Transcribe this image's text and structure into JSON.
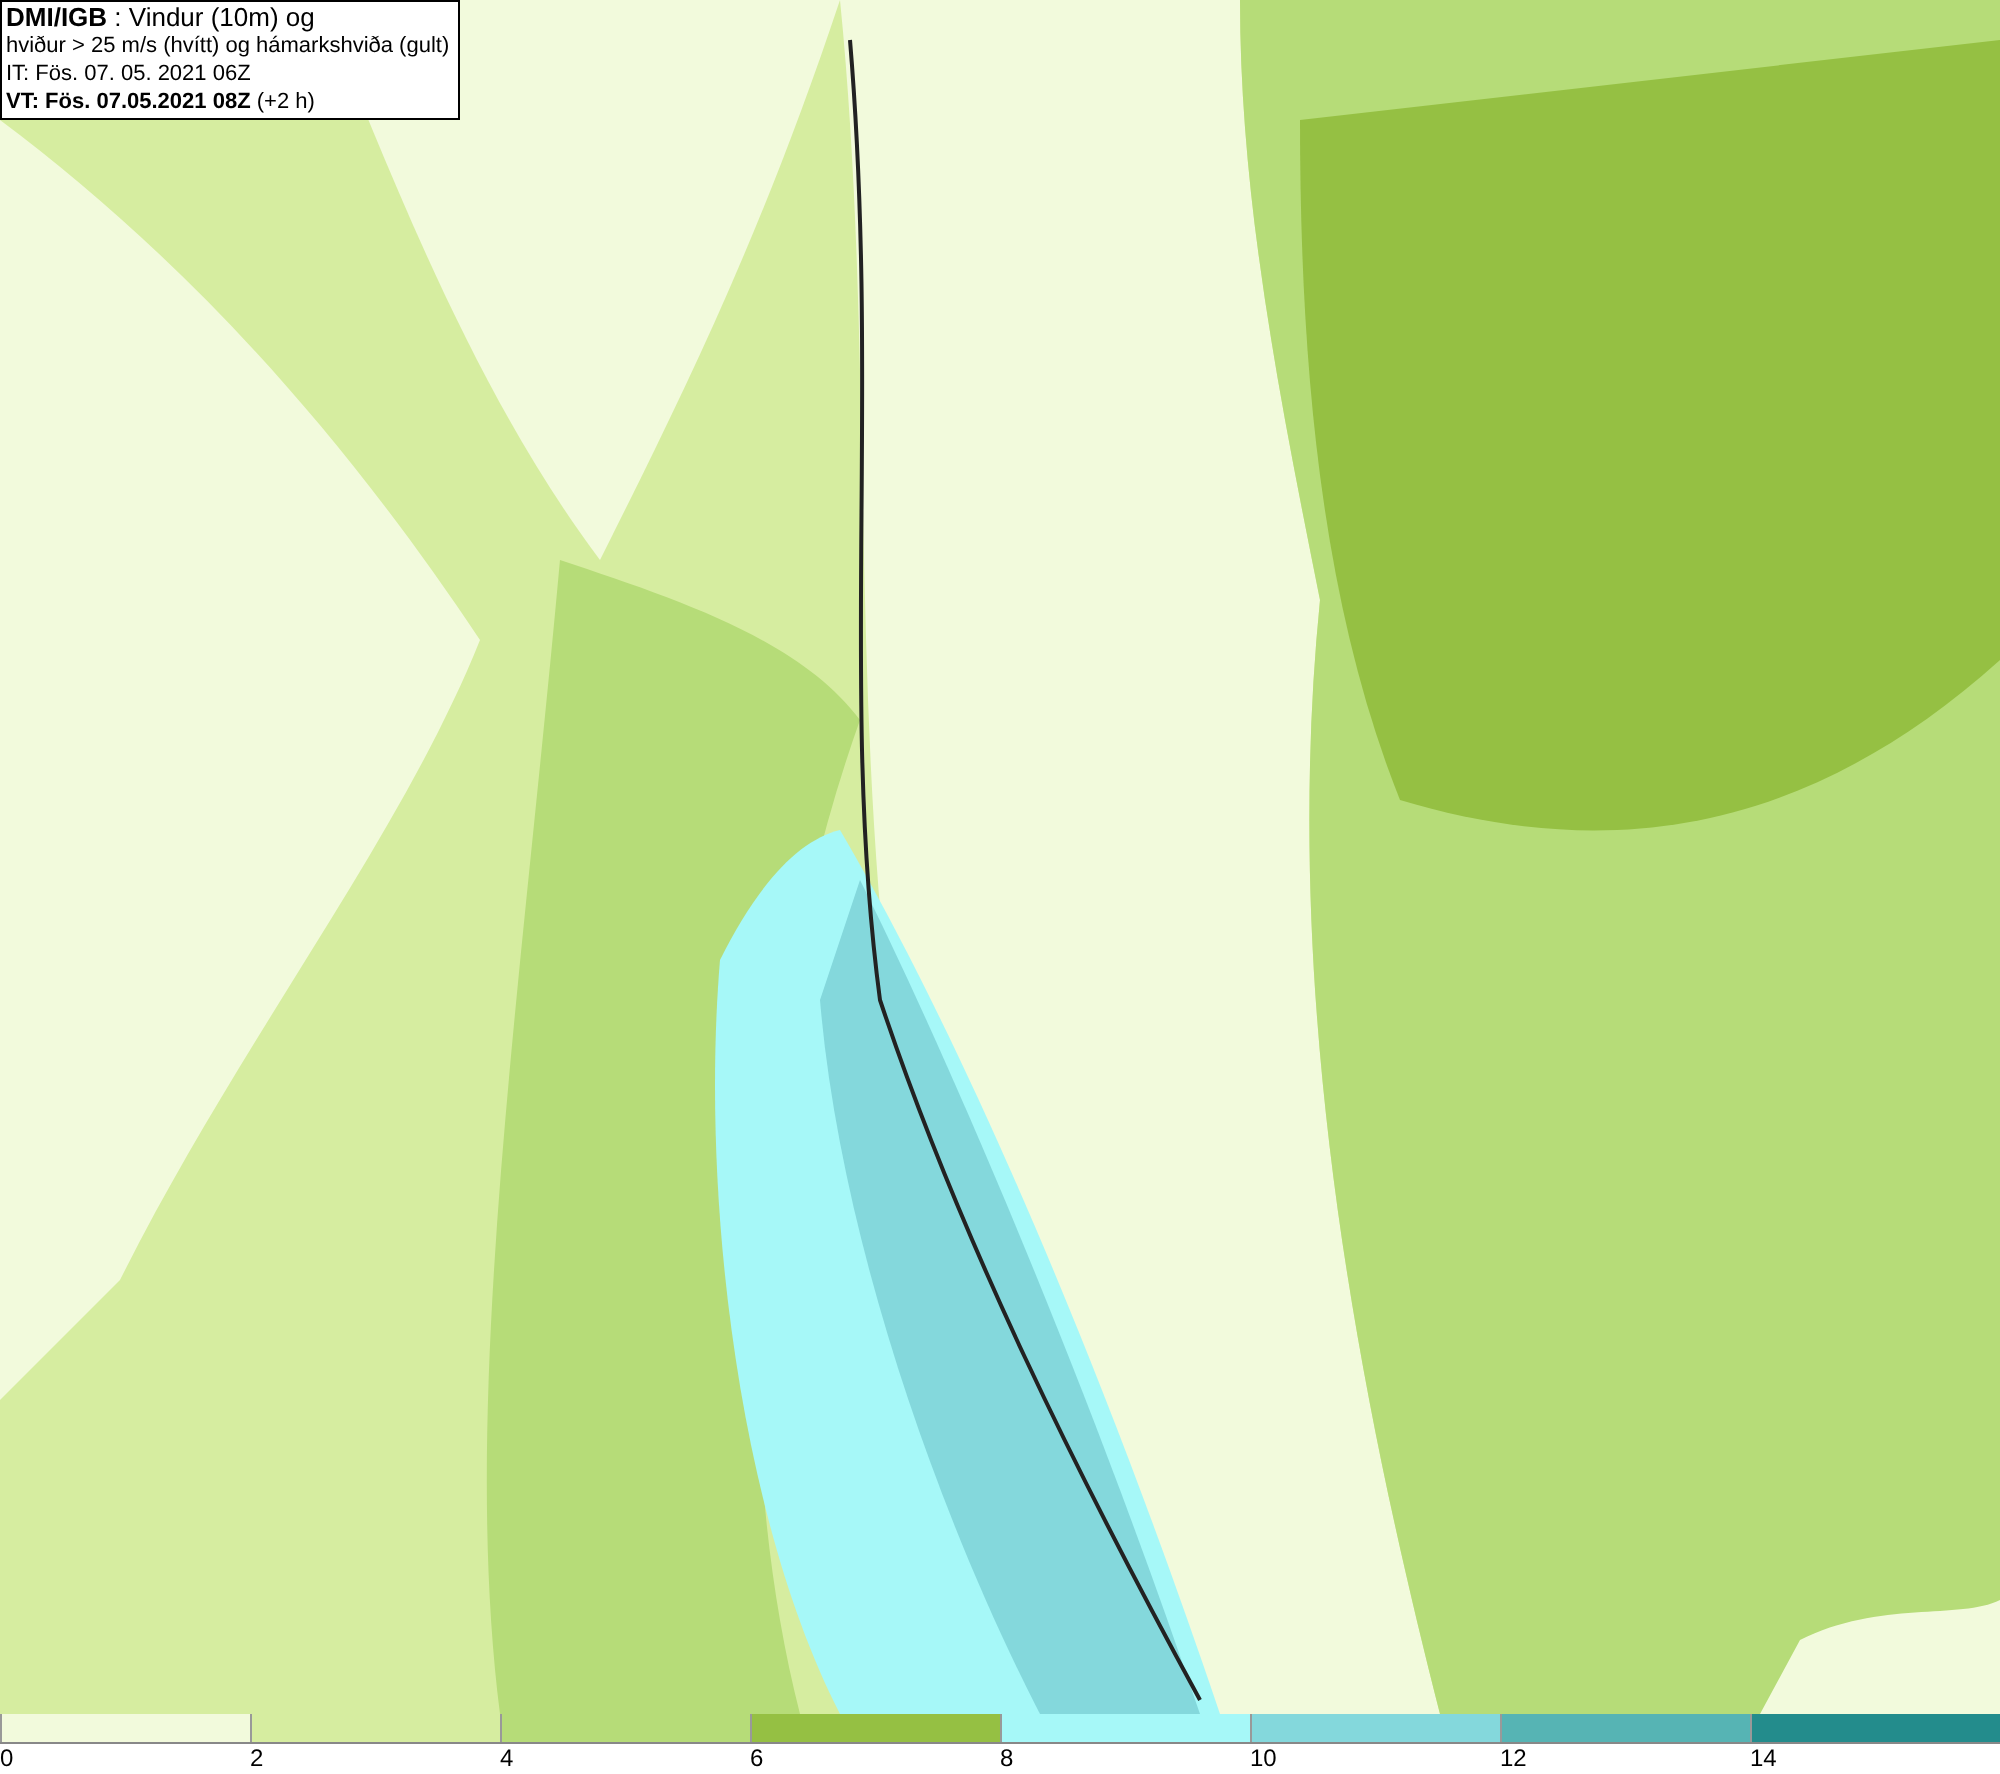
{
  "title_lines": [
    "**DMI/IGB** : Vindur (10m) og",
    "hviður > 25 m/s (hvítt) og hámarkshviða (gult)",
    "IT: Fös. 07. 05. 2021 06Z",
    "**VT: Fös. 07.05.2021 08Z** (+2 h)"
  ],
  "legend": {
    "bins": [
      {
        "color": "#f2fadc"
      },
      {
        "color": "#d6eda0"
      },
      {
        "color": "#b6dc78"
      },
      {
        "color": "#95c043"
      },
      {
        "color": "#a6f8f8"
      },
      {
        "color": "#84d8dc"
      },
      {
        "color": "#56b4b4"
      },
      {
        "color": "#238c8c"
      }
    ],
    "ticks": [
      "0",
      "2",
      "4",
      "6",
      "8",
      "10",
      "12",
      "14"
    ]
  }
}
